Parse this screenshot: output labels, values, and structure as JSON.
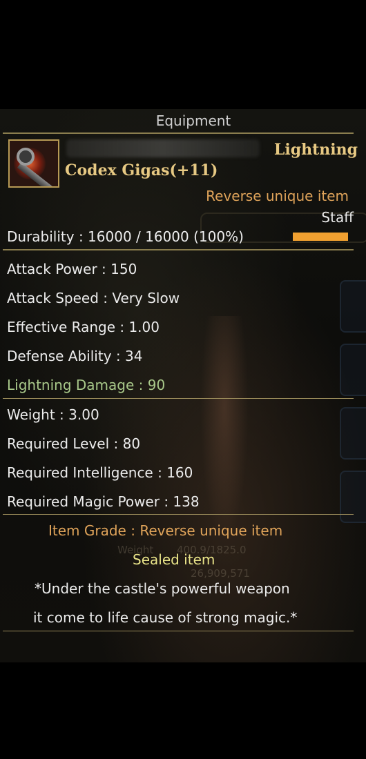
{
  "panel": {
    "title": "Equipment"
  },
  "item": {
    "element": "Lightning",
    "name": "Codex Gigas(+11)",
    "rarity": "Reverse unique item",
    "type": "Staff",
    "durability_text": "Durability : 16000 / 16000 (100%)",
    "durability_fraction": 1.0
  },
  "stats": [
    {
      "text": "Attack Power : 150"
    },
    {
      "text": "Attack Speed : Very Slow"
    },
    {
      "text": "Effective Range : 1.00"
    },
    {
      "text": "Defense Ability : 34"
    },
    {
      "text": "Lightning Damage : 90"
    }
  ],
  "requirements": [
    {
      "text": "Weight : 3.00"
    },
    {
      "text": "Required Level : 80"
    },
    {
      "text": "Required Intelligence : 160"
    },
    {
      "text": "Required Magic Power : 138"
    }
  ],
  "footer": {
    "grade": "Item Grade : Reverse unique item",
    "sealed": "Sealed item",
    "lore_line1": "*Under the castle's powerful weapon",
    "lore_line2": "it come to life cause of strong magic.*"
  },
  "background": {
    "weight_label": "Weight",
    "weight_value": "400.9/1825.0",
    "gold_value": "26,909,571"
  },
  "colors": {
    "element": "#e7c983",
    "name": "#e7c983",
    "rarity": "#e0a45a",
    "stat": "#ececec",
    "elemental_stat": "#a9c98a",
    "sealed": "#e9e489",
    "durability_bar": "#f0a030",
    "rule": "#8a7d4e"
  },
  "icons": [
    "staff-icon"
  ]
}
